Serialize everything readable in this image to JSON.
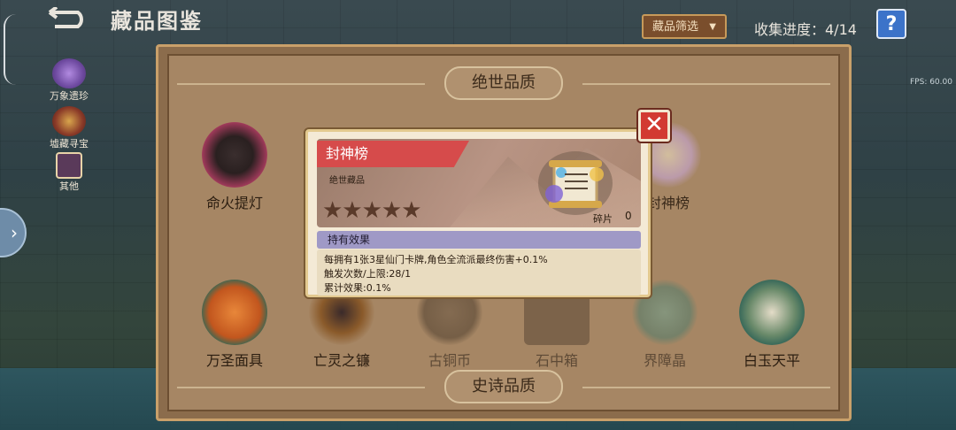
{
  "header": {
    "back_icon": "back-arrow-icon",
    "title": "藏品图鉴",
    "filter_label": "藏品筛选",
    "progress_label": "收集进度：4/14",
    "help_label": "?",
    "fps": "FPS: 60.00"
  },
  "sidebar": {
    "tabs": [
      {
        "label": "万象遗珍",
        "selected": false
      },
      {
        "label": "墟藏寻宝",
        "selected": false
      },
      {
        "label": "其他",
        "selected": true
      }
    ],
    "expand_icon": "chevron-right-icon"
  },
  "sections": {
    "top": "绝世品质",
    "bottom": "史诗品质"
  },
  "items_row1": [
    {
      "name": "命火提灯",
      "owned": true
    },
    {
      "name": "封神榜",
      "owned": true
    }
  ],
  "items_row2": [
    {
      "name": "万圣面具",
      "owned": true
    },
    {
      "name": "亡灵之镰",
      "owned": true
    },
    {
      "name": "古铜币",
      "owned": false
    },
    {
      "name": "石中箱",
      "owned": false
    },
    {
      "name": "界障晶",
      "owned": false
    },
    {
      "name": "白玉天平",
      "owned": true
    }
  ],
  "modal": {
    "name": "封神榜",
    "rarity": "绝世藏品",
    "stars": "★★★★★",
    "star_count": 5,
    "shard_label": "碎片",
    "shard_count": "0",
    "effect_header": "持有效果",
    "effect_lines": [
      "每拥有1张3星仙门卡牌,角色全流派最终伤害+0.1%",
      "触发次数/上限:28/1",
      "累计效果:0.1%"
    ],
    "close_icon": "close-icon"
  },
  "colors": {
    "panel": "#8b6c4c",
    "ribbon": "#d64b4b",
    "effect_bar": "#9f99c6",
    "close": "#d23a32"
  }
}
